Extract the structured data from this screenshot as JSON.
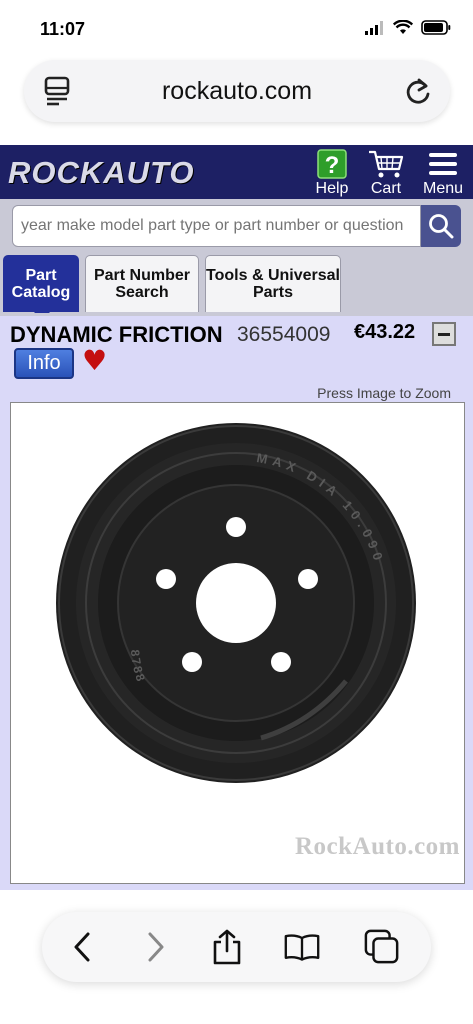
{
  "status_bar": {
    "time": "11:07"
  },
  "browser": {
    "url": "rockauto.com",
    "toolbar": {
      "back": "back-icon",
      "forward": "forward-icon",
      "share": "share-icon",
      "bookmarks": "bookmarks-icon",
      "tabs": "tabs-icon"
    }
  },
  "header": {
    "logo": "ROCKAUTO",
    "help_label": "Help",
    "cart_label": "Cart",
    "menu_label": "Menu"
  },
  "search": {
    "placeholder": "year make model part type or part number or question"
  },
  "tabs": [
    {
      "label": "Part Catalog",
      "active": true
    },
    {
      "label": "Part Number Search",
      "active": false
    },
    {
      "label": "Tools & Universal Parts",
      "active": false
    }
  ],
  "product": {
    "brand": "DYNAMIC FRICTION",
    "part_number": "36554009",
    "price": "€43.22",
    "info_label": "Info",
    "zoom_hint": "Press Image to Zoom",
    "image_text": {
      "rim_label": "MAX DIA 10.090",
      "casting_no": "8788"
    },
    "watermark": "RockAuto.com"
  },
  "colors": {
    "header_bg": "#1d2064",
    "tab_active": "#23309a",
    "product_bg": "#dad9f8",
    "heart": "#c40f10"
  }
}
